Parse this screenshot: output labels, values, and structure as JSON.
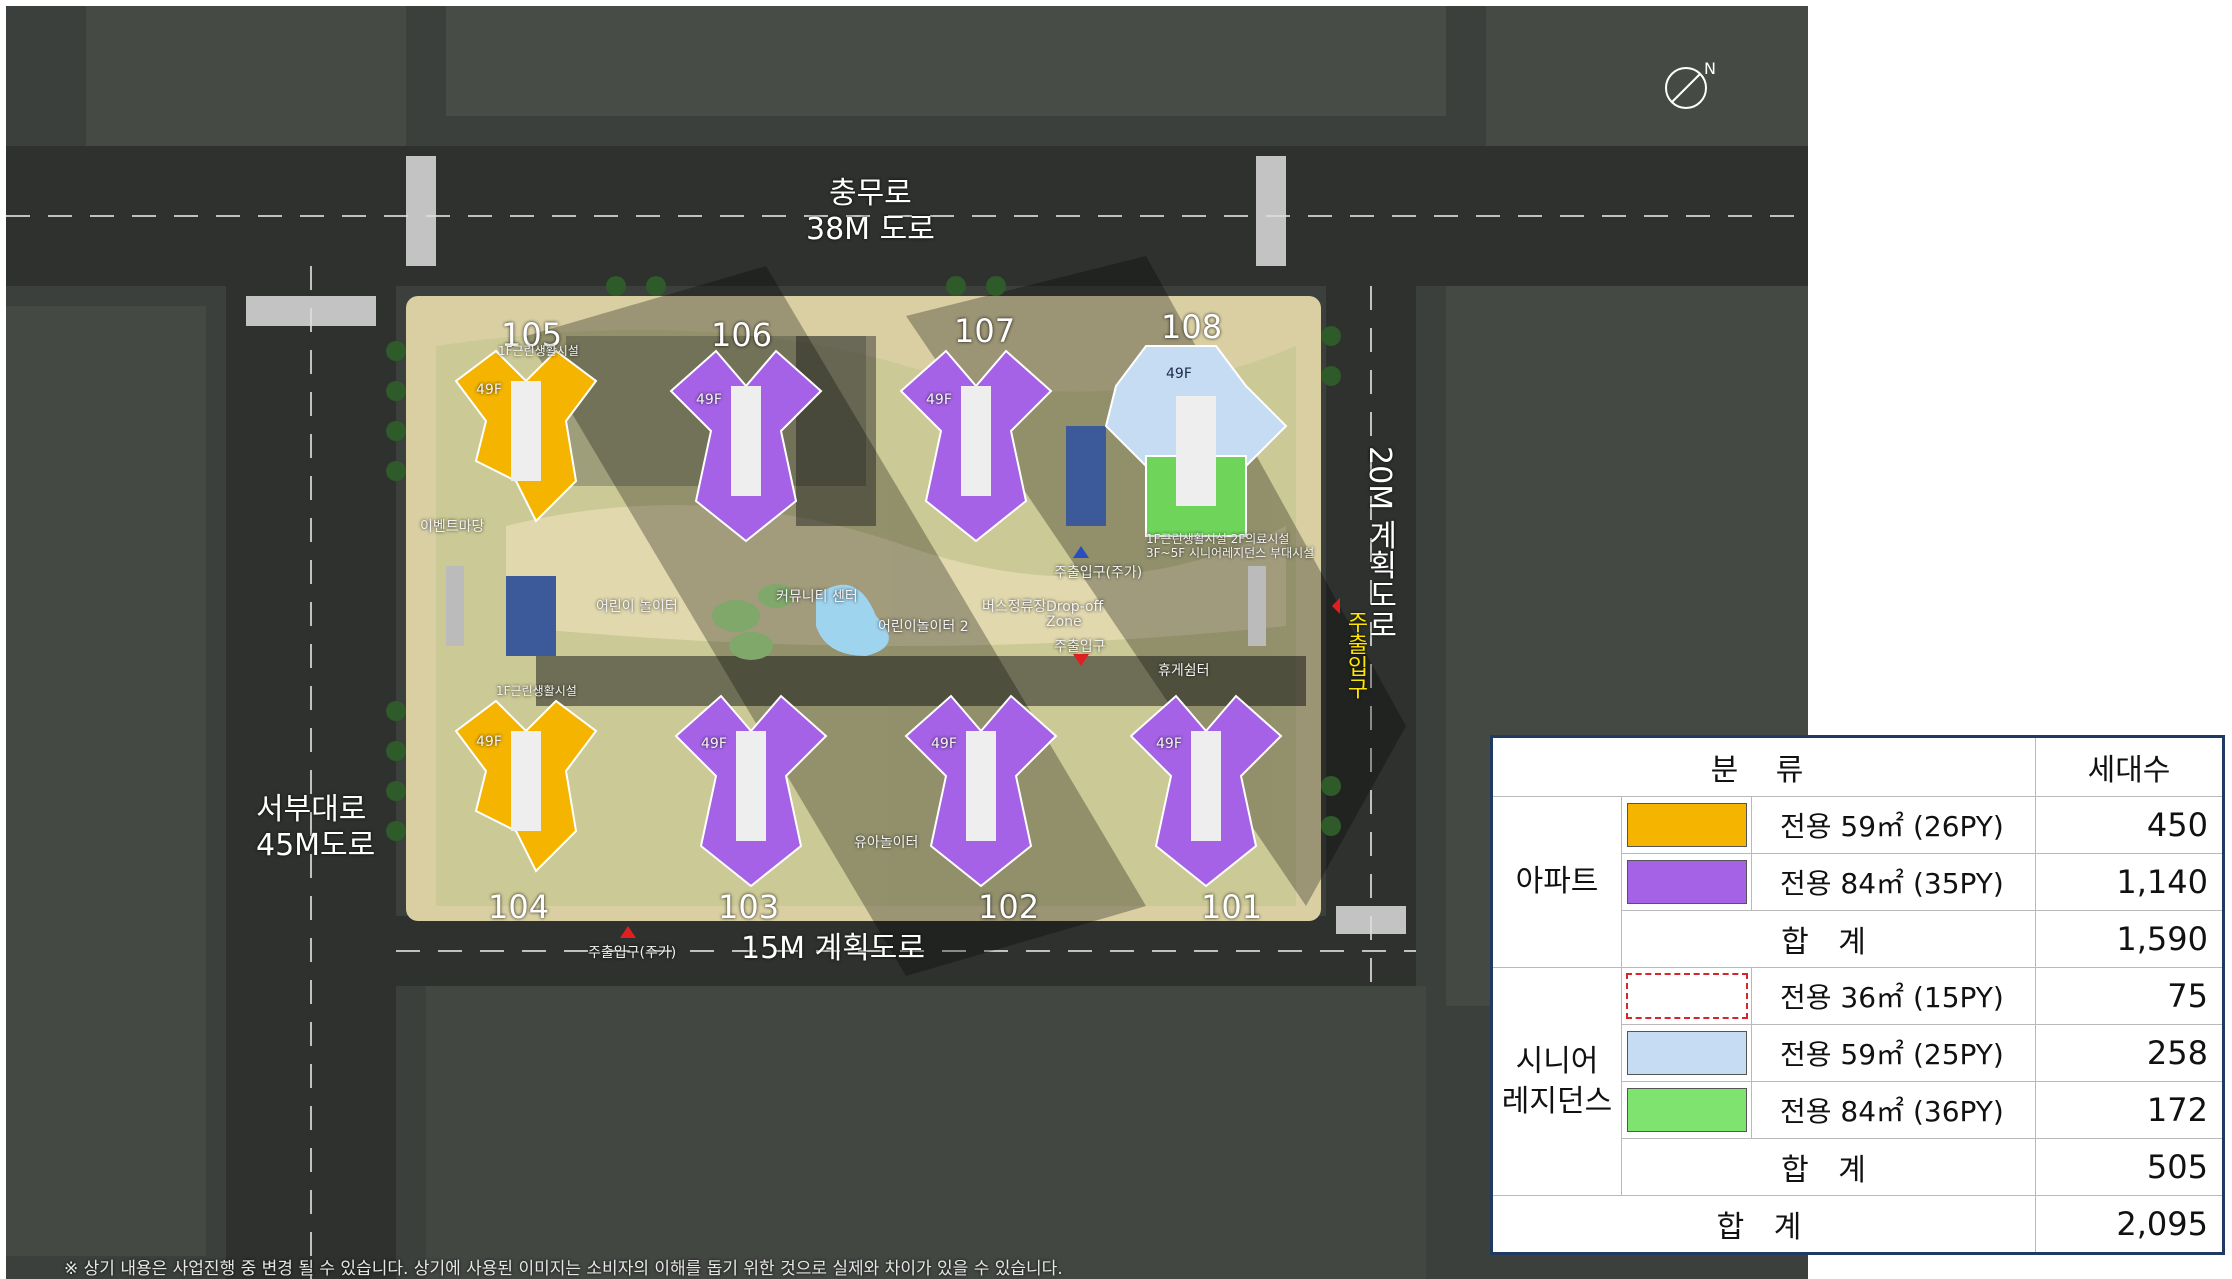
{
  "map": {
    "roads": {
      "north": {
        "name": "충무로",
        "width": "38M 도로"
      },
      "west": {
        "name": "서부대로",
        "width": "45M도로"
      },
      "south": {
        "name": "15M 계획도로"
      },
      "east": {
        "name": "20M 계획도로"
      }
    },
    "buildings": [
      {
        "number": "105",
        "type": "apartment-59"
      },
      {
        "number": "106",
        "type": "apartment-84"
      },
      {
        "number": "107",
        "type": "apartment-84"
      },
      {
        "number": "108",
        "type": "senior-residence"
      },
      {
        "number": "104",
        "type": "apartment-59"
      },
      {
        "number": "103",
        "type": "apartment-84"
      },
      {
        "number": "102",
        "type": "apartment-84"
      },
      {
        "number": "101",
        "type": "apartment-84"
      }
    ],
    "floor_label": "49F",
    "facility_labels": {
      "event_plaza": "이벤트마당",
      "kids_playground": "어린이 놀이터",
      "community_center": "커뮤니티 센터",
      "kids_playground_2": "어린이놀이터 2",
      "bus_stop": "버스정류장",
      "drop_off": "Drop-off Zone",
      "toddler_playground": "유아놀이터",
      "rest_area": "휴게쉼터",
      "store_1f": "1F근린생활시설",
      "senior_facility": "1F근린생활시설 2F의료시설 3F~5F 시니어레지던스 부대시설",
      "entrance": "주출입구",
      "entrance_main": "주출입구(주가)",
      "vehicle_exit": "주출입구(주가)",
      "east_entrance": "주출입구"
    },
    "colors": {
      "apartment_59": "#f5b400",
      "apartment_84": "#a562e6",
      "senior_59": "#c6dcf3",
      "senior_84": "#6fd45a",
      "senior_36_border": "#d6262b",
      "ground": "#3a3e3a",
      "site": "#d9cfa3"
    },
    "disclaimer": "※ 상기 내용은 사업진행 중 변경 될 수 있습니다. 상기에 사용된 이미지는 소비자의 이해를 돕기 위한 것으로 실제와 차이가 있을 수 있습니다."
  },
  "legend": {
    "header": {
      "category": "분 류",
      "households": "세대수"
    },
    "groups": [
      {
        "name": "아파트",
        "rows": [
          {
            "swatch": "#f5b400",
            "swatch_style": "solid",
            "label": "전용  59㎡ (26PY)",
            "value": "450"
          },
          {
            "swatch": "#a562e6",
            "swatch_style": "solid",
            "label": "전용  84㎡ (35PY)",
            "value": "1,140"
          }
        ],
        "subtotal_label": "합 계",
        "subtotal": "1,590"
      },
      {
        "name": "시니어\n레지던스",
        "rows": [
          {
            "swatch": "#ffffff",
            "swatch_style": "dashed-red",
            "label": "전용  36㎡ (15PY)",
            "value": "75"
          },
          {
            "swatch": "#c6dcf3",
            "swatch_style": "solid",
            "label": "전용  59㎡ (25PY)",
            "value": "258"
          },
          {
            "swatch": "#7ee36f",
            "swatch_style": "solid",
            "label": "전용  84㎡ (36PY)",
            "value": "172"
          }
        ],
        "subtotal_label": "합 계",
        "subtotal": "505"
      }
    ],
    "total_label": "합 계",
    "total": "2,095"
  }
}
